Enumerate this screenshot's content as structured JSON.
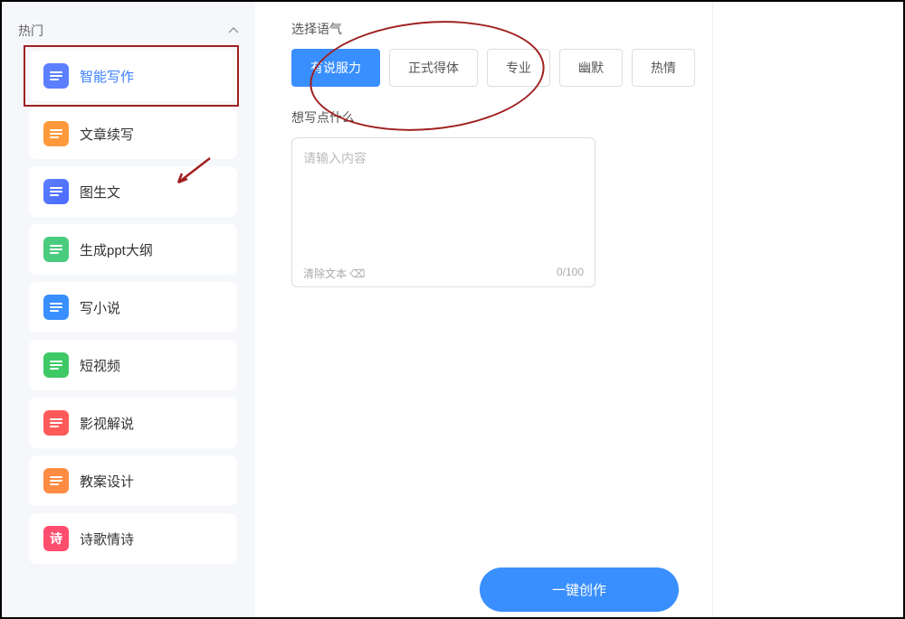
{
  "sidebar": {
    "section_header": "热门",
    "items": [
      {
        "label": "智能写作",
        "icon": "icon-blue",
        "active": true
      },
      {
        "label": "文章续写",
        "icon": "icon-orange",
        "active": false
      },
      {
        "label": "图生文",
        "icon": "icon-bluegrad",
        "active": false
      },
      {
        "label": "生成ppt大纲",
        "icon": "icon-green",
        "active": false
      },
      {
        "label": "写小说",
        "icon": "icon-blue2",
        "active": false
      },
      {
        "label": "短视频",
        "icon": "icon-green2",
        "active": false
      },
      {
        "label": "影视解说",
        "icon": "icon-red",
        "active": false
      },
      {
        "label": "教案设计",
        "icon": "icon-orange2",
        "active": false
      },
      {
        "label": "诗歌情诗",
        "icon": "icon-redrose",
        "active": false,
        "badge": "诗"
      }
    ]
  },
  "main": {
    "tone_label": "选择语气",
    "tones": [
      {
        "label": "有说服力",
        "active": true
      },
      {
        "label": "正式得体",
        "active": false
      },
      {
        "label": "专业",
        "active": false
      },
      {
        "label": "幽默",
        "active": false
      },
      {
        "label": "热情",
        "active": false
      }
    ],
    "content_label": "想写点什么",
    "content_placeholder": "请输入内容",
    "clear_text": "清除文本 ⌫",
    "char_count": "0/100",
    "create_button": "一键创作"
  }
}
